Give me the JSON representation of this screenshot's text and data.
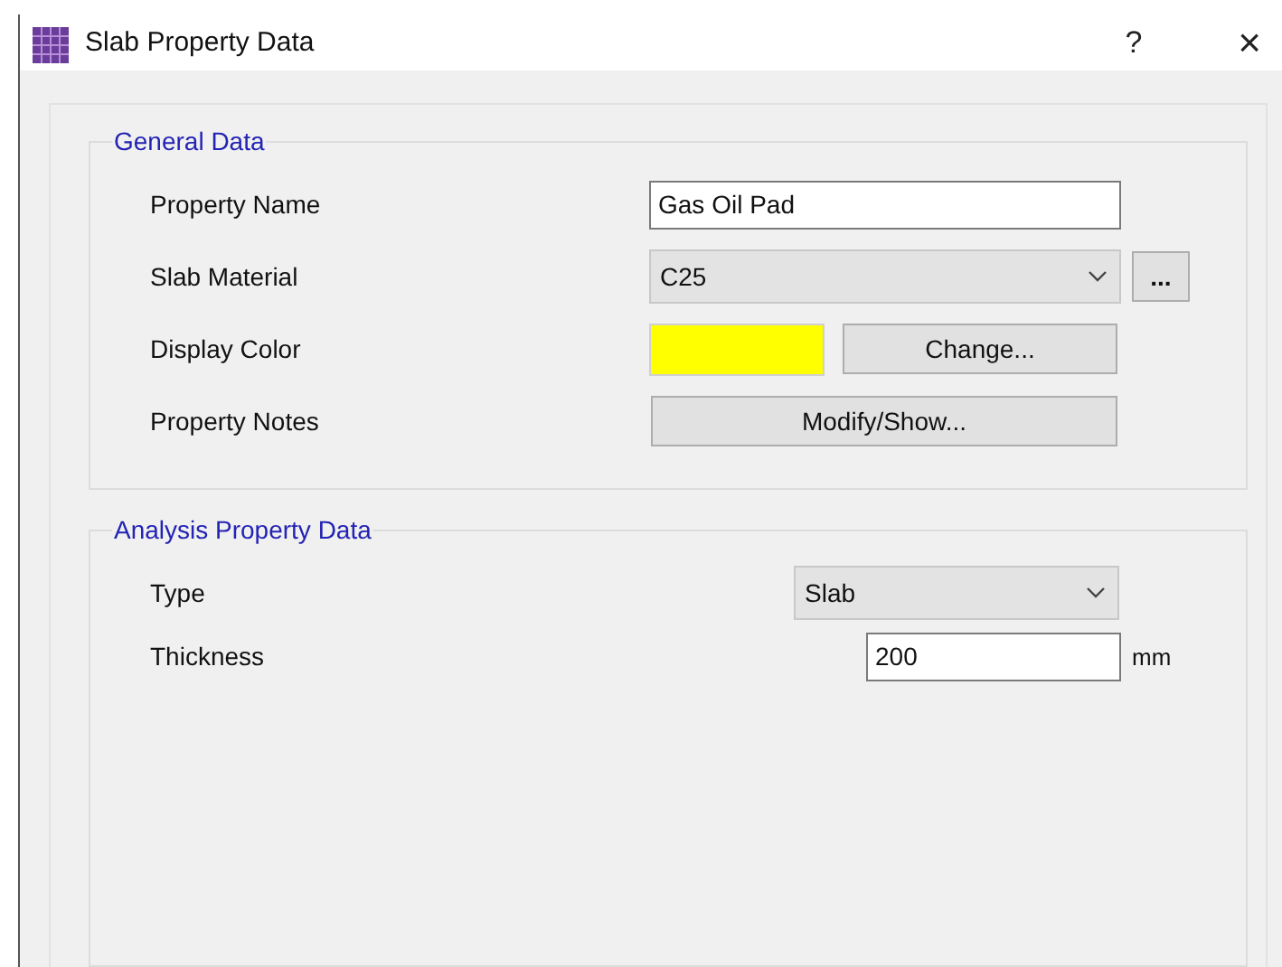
{
  "window": {
    "title": "Slab Property Data",
    "help": "?",
    "close": "×"
  },
  "general_data": {
    "title": "General Data",
    "rows": [
      {
        "kind": "text",
        "label": "Property Name",
        "value": "Gas Oil Pad"
      },
      {
        "kind": "combo",
        "label": "Slab Material",
        "value": "C25",
        "extra_button": "..."
      },
      {
        "kind": "color",
        "label": "Display Color",
        "color": "#ffff00",
        "button": "Change..."
      },
      {
        "kind": "button",
        "label": "Property Notes",
        "button": "Modify/Show..."
      }
    ]
  },
  "analysis_data": {
    "title": "Analysis Property Data",
    "rows": [
      {
        "kind": "combo",
        "label": "Type",
        "value": "Slab"
      },
      {
        "kind": "text",
        "label": "Thickness",
        "value": "200",
        "unit": "mm"
      }
    ]
  }
}
